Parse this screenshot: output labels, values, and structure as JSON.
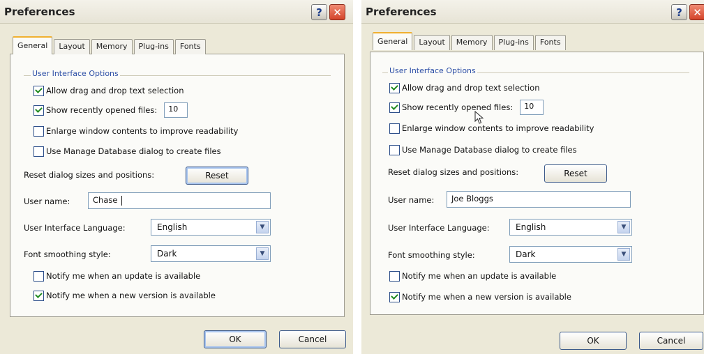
{
  "dialogs": [
    {
      "title": "Preferences",
      "tabs": [
        "General",
        "Layout",
        "Memory",
        "Plug-ins",
        "Fonts"
      ],
      "group_label": "User Interface Options",
      "options": {
        "allow_drag": "Allow drag and drop text selection",
        "show_recent": "Show recently opened files:",
        "recent_count": "10",
        "enlarge": "Enlarge window contents to improve readability",
        "manage_db": "Use Manage Database dialog to create files"
      },
      "reset_label": "Reset dialog sizes and positions:",
      "reset_button": "Reset",
      "username_label": "User name:",
      "username_value": "Chase",
      "language_label": "User Interface Language:",
      "language_value": "English",
      "font_smoothing_label": "Font smoothing style:",
      "font_smoothing_value": "Dark",
      "notify_update": "Notify me when an update is available",
      "notify_version": "Notify me when a new version is available",
      "ok_button": "OK",
      "cancel_button": "Cancel",
      "icons": {
        "help": "question-icon",
        "close": "close-icon"
      }
    },
    {
      "title": "Preferences",
      "tabs": [
        "General",
        "Layout",
        "Memory",
        "Plug-ins",
        "Fonts"
      ],
      "group_label": "User Interface Options",
      "options": {
        "allow_drag": "Allow drag and drop text selection",
        "show_recent": "Show recently opened files:",
        "recent_count": "10",
        "enlarge": "Enlarge window contents to improve readability",
        "manage_db": "Use Manage Database dialog to create files"
      },
      "reset_label": "Reset dialog sizes and positions:",
      "reset_button": "Reset",
      "username_label": "User name:",
      "username_value": "Joe Bloggs",
      "language_label": "User Interface Language:",
      "language_value": "English",
      "font_smoothing_label": "Font smoothing style:",
      "font_smoothing_value": "Dark",
      "notify_update": "Notify me when an update is available",
      "notify_version": "Notify me when a new version is available",
      "ok_button": "OK",
      "cancel_button": "Cancel",
      "icons": {
        "help": "question-icon",
        "close": "close-icon"
      }
    }
  ]
}
